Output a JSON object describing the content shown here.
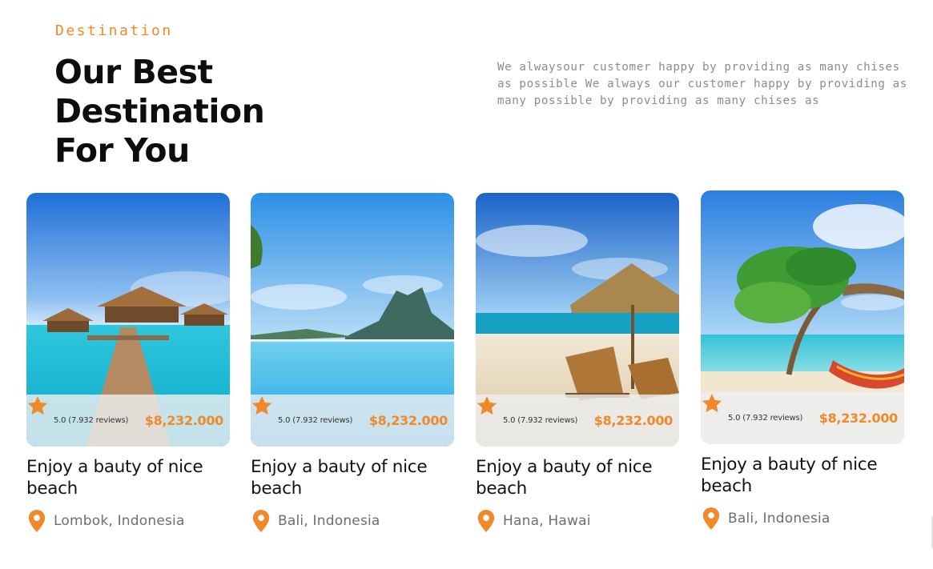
{
  "section": {
    "eyebrow": "Destination",
    "title_line1": "Our Best Destination",
    "title_line2": "For You",
    "description": "We alwaysour customer happy by providing as many chises as possible We always our customer happy by providing as many possible by providing as many chises as"
  },
  "colors": {
    "accent": "#f0892a",
    "heading": "#0d0d0d",
    "muted": "#8c8c8c"
  },
  "icons": {
    "rating": "star-icon",
    "location": "map-pin-icon"
  },
  "cards": [
    {
      "rating": "5.0 (7.932 reviews)",
      "price": "$8,232.000",
      "title": "Enjoy a bauty of nice beach",
      "location": "Lombok, Indonesia",
      "scene": "overwater-bungalow-pier"
    },
    {
      "rating": "5.0 (7.932 reviews)",
      "price": "$8,232.000",
      "title": "Enjoy a bauty of nice beach",
      "location": "Bali, Indonesia",
      "scene": "infinity-pool-mountain"
    },
    {
      "rating": "5.0 (7.932 reviews)",
      "price": "$8,232.000",
      "title": "Enjoy a bauty of nice beach",
      "location": "Hana, Hawai",
      "scene": "beach-umbrella-loungers"
    },
    {
      "rating": "5.0 (7.932 reviews)",
      "price": "$8,232.000",
      "title": "Enjoy a bauty of nice beach",
      "location": "Bali, Indonesia",
      "scene": "palm-hammock-beach"
    }
  ]
}
